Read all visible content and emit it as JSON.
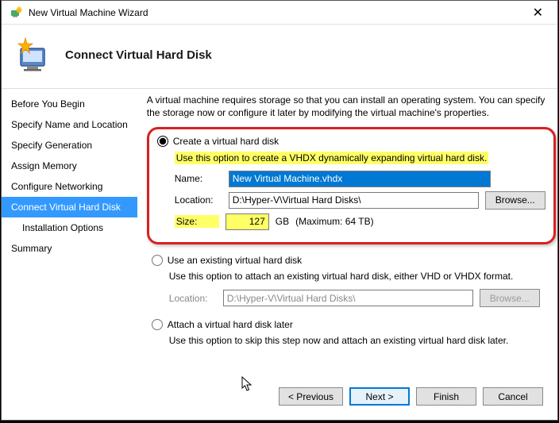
{
  "window": {
    "title": "New Virtual Machine Wizard"
  },
  "header": {
    "title": "Connect Virtual Hard Disk"
  },
  "sidebar": {
    "items": [
      {
        "label": "Before You Begin"
      },
      {
        "label": "Specify Name and Location"
      },
      {
        "label": "Specify Generation"
      },
      {
        "label": "Assign Memory"
      },
      {
        "label": "Configure Networking"
      },
      {
        "label": "Connect Virtual Hard Disk"
      },
      {
        "label": "Installation Options"
      },
      {
        "label": "Summary"
      }
    ]
  },
  "content": {
    "intro": "A virtual machine requires storage so that you can install an operating system. You can specify the storage now or configure it later by modifying the virtual machine's properties.",
    "opt_create": {
      "label": "Create a virtual hard disk",
      "desc": "Use this option to create a VHDX dynamically expanding virtual hard disk.",
      "name_label": "Name:",
      "name_value": "New Virtual Machine.vhdx",
      "loc_label": "Location:",
      "loc_value": "D:\\Hyper-V\\Virtual Hard Disks\\",
      "browse": "Browse...",
      "size_label": "Size:",
      "size_value": "127",
      "size_unit": "GB",
      "size_max": "(Maximum: 64 TB)"
    },
    "opt_existing": {
      "label": "Use an existing virtual hard disk",
      "desc": "Use this option to attach an existing virtual hard disk, either VHD or VHDX format.",
      "loc_label": "Location:",
      "loc_value": "D:\\Hyper-V\\Virtual Hard Disks\\",
      "browse": "Browse..."
    },
    "opt_later": {
      "label": "Attach a virtual hard disk later",
      "desc": "Use this option to skip this step now and attach an existing virtual hard disk later."
    }
  },
  "footer": {
    "previous": "< Previous",
    "next": "Next >",
    "finish": "Finish",
    "cancel": "Cancel"
  }
}
